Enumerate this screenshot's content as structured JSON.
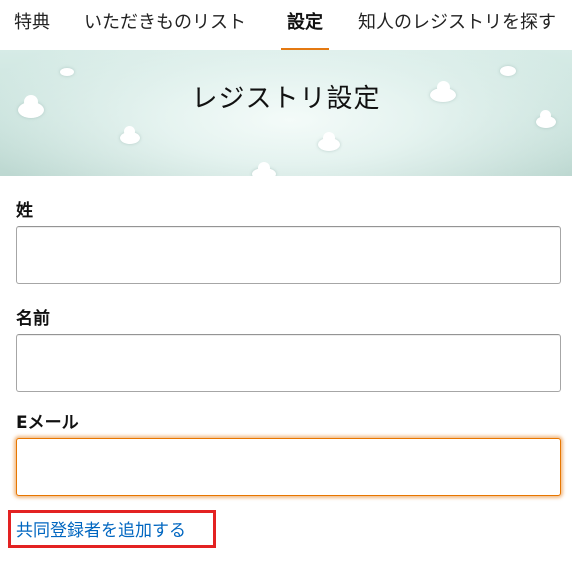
{
  "tabs": [
    {
      "label": "特典",
      "active": false
    },
    {
      "label": "いただきものリスト",
      "active": false
    },
    {
      "label": "設定",
      "active": true
    },
    {
      "label": "知人のレジストリを探す",
      "active": false
    }
  ],
  "banner": {
    "title": "レジストリ設定"
  },
  "form": {
    "last_name_label": "姓",
    "last_name_value": "",
    "first_name_label": "名前",
    "first_name_value": "",
    "email_label": "Eメール",
    "email_value": ""
  },
  "add_coregistrant_link": "共同登録者を追加する",
  "colors": {
    "accent": "#e47911",
    "link": "#0066c0",
    "highlight_box": "#e32222"
  }
}
